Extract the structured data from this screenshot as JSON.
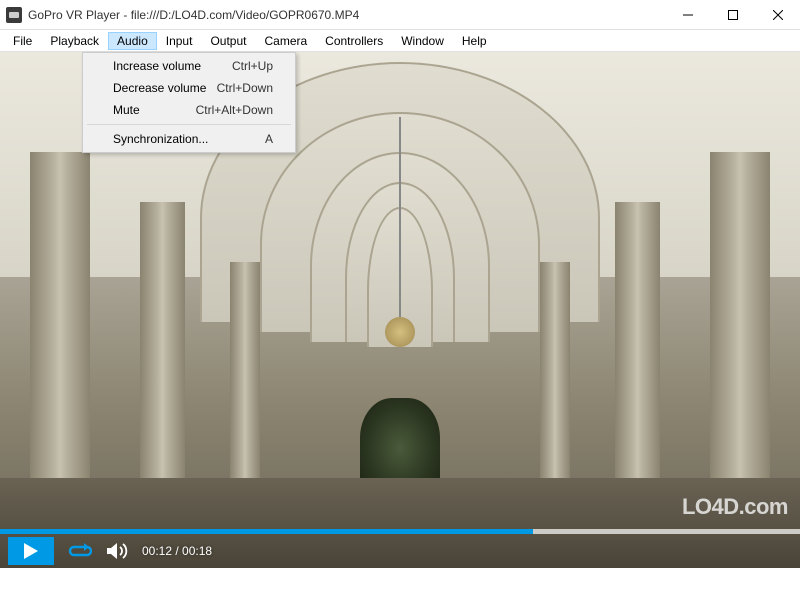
{
  "window": {
    "title": "GoPro VR Player - file:///D:/LO4D.com/Video/GOPR0670.MP4"
  },
  "menubar": {
    "items": [
      "File",
      "Playback",
      "Audio",
      "Input",
      "Output",
      "Camera",
      "Controllers",
      "Window",
      "Help"
    ],
    "active_index": 2
  },
  "dropdown": {
    "items": [
      {
        "label": "Increase volume",
        "shortcut": "Ctrl+Up"
      },
      {
        "label": "Decrease volume",
        "shortcut": "Ctrl+Down"
      },
      {
        "label": "Mute",
        "shortcut": "Ctrl+Alt+Down"
      }
    ],
    "items2": [
      {
        "label": "Synchronization...",
        "shortcut": "A"
      }
    ]
  },
  "player": {
    "current_time": "00:12",
    "total_time": "00:18",
    "time_display": "00:12 / 00:18",
    "progress_percent": 66.6
  },
  "watermark": {
    "text_part1": "LO4D",
    "text_part2": ".com"
  },
  "colors": {
    "accent": "#0099e5"
  }
}
